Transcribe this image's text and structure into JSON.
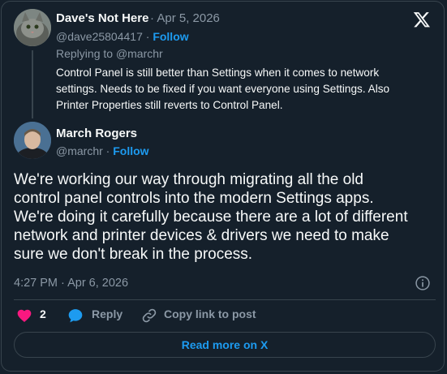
{
  "reply": {
    "author_name": "Dave's Not Here",
    "separator": "·",
    "date": "Apr 5, 2026",
    "handle": "@dave25804417",
    "follow_label": "Follow",
    "replying_prefix": "Replying to",
    "replying_handle": "@marchr",
    "text_lines": [
      "Control Panel is still better than Settings when it comes to network",
      "settings. Needs to be fixed if you want everyone using Settings. Also",
      "Printer Properties still reverts to Control Panel."
    ]
  },
  "post": {
    "author_name": "March Rogers",
    "handle": "@marchr",
    "follow_label": "Follow",
    "text_lines": [
      "We're working our way through migrating all the old",
      "control panel controls into the modern Settings apps.",
      "We're doing it carefully because there are a lot of different",
      "network and printer devices & drivers we need to make",
      "sure we don't break in the process."
    ],
    "timestamp": "4:27 PM · Apr 6, 2026"
  },
  "actions": {
    "like_count": "2",
    "reply_label": "Reply",
    "copy_link_label": "Copy link to post"
  },
  "read_more_label": "Read more on X",
  "colors": {
    "background": "#15202b",
    "accent": "#1d9bf0",
    "like": "#f91880",
    "muted": "#8b98a5",
    "border": "#38444d"
  },
  "icons": [
    "x-logo-icon",
    "info-icon",
    "heart-icon",
    "reply-bubble-icon",
    "link-icon"
  ]
}
